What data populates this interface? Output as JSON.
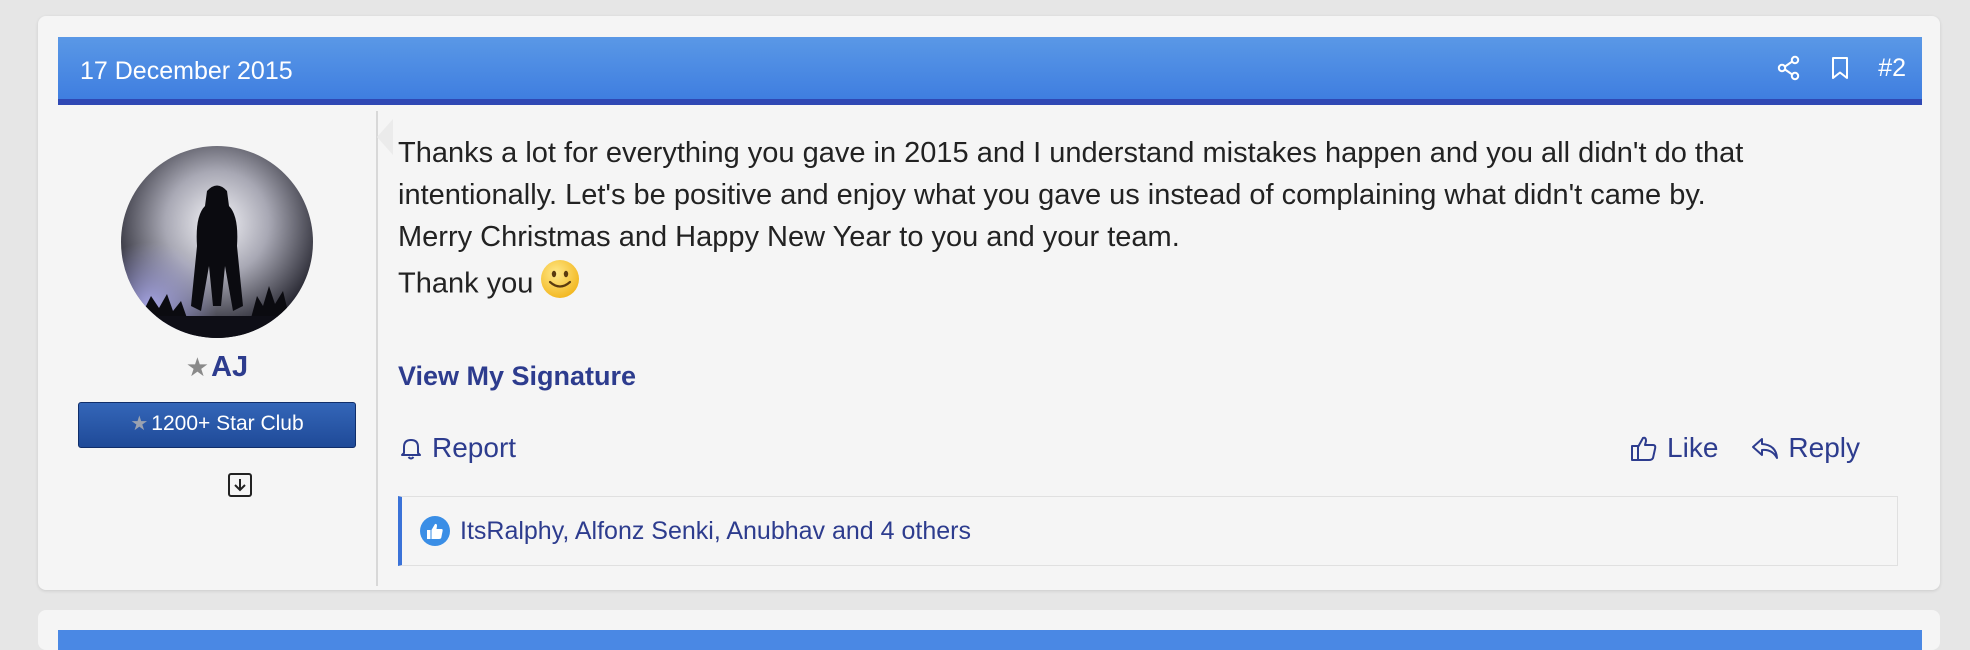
{
  "post": {
    "date": "17 December 2015",
    "number": "#2",
    "header_icons": [
      "share-icon",
      "bookmark-icon"
    ]
  },
  "user": {
    "name": "AJ",
    "rank_label": "1200+ Star Club"
  },
  "message": {
    "lines": [
      "Thanks a lot for everything you gave in 2015 and I understand mistakes happen and you all didn't do that",
      "intentionally. Let's be positive and enjoy what you gave us instead of complaining what didn't came by.",
      "Merry Christmas and Happy New Year to you and your team.",
      "Thank you"
    ]
  },
  "signature_link": "View My Signature",
  "actions": {
    "report": "Report",
    "like": "Like",
    "reply": "Reply"
  },
  "likes": {
    "text": "ItsRalphy, Alfonz Senki, Anubhav and 4 others"
  },
  "colors": {
    "header_blue": "#4a88e4",
    "header_border": "#2f48b4",
    "link_blue": "#2d3c8e",
    "badge_blue": "#2a58a8"
  }
}
